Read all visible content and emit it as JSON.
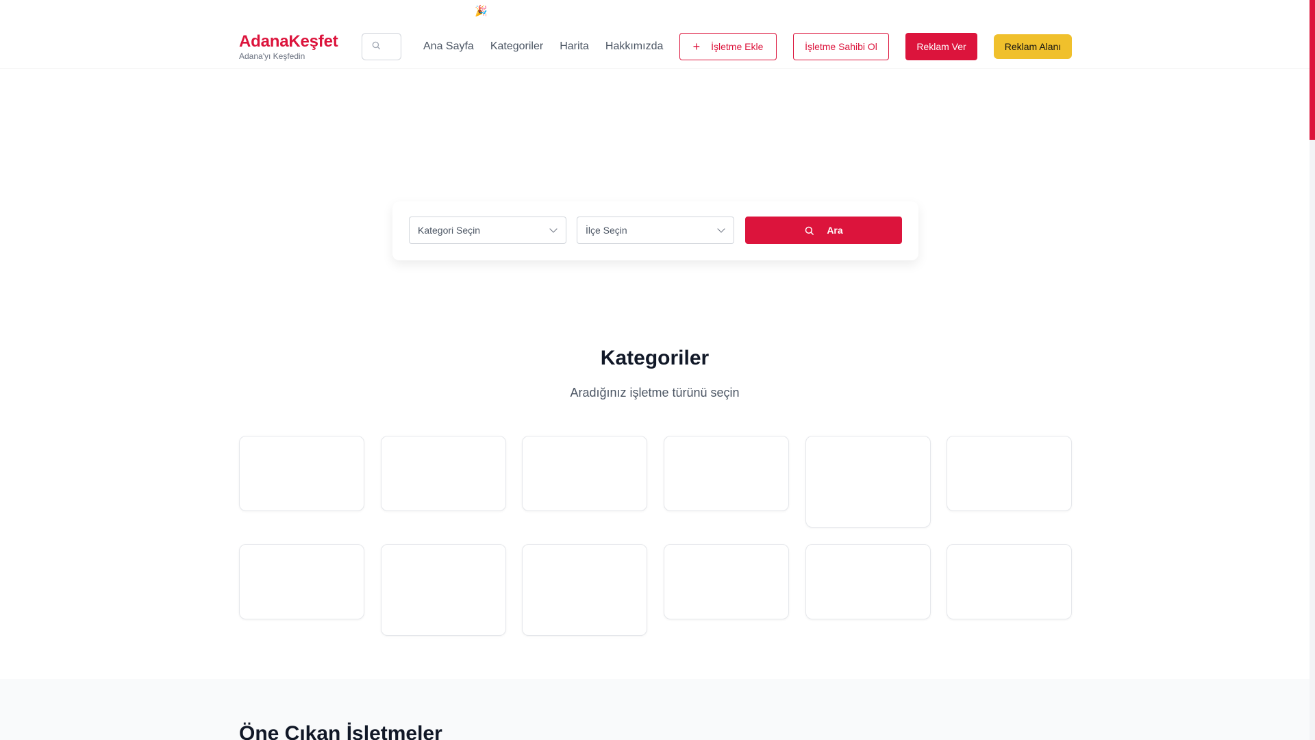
{
  "announcement": {
    "icon": "party-popper-icon",
    "text": "🎉"
  },
  "brand": {
    "title": "AdanaKeşfet",
    "subtitle": "Adana'yı Keşfedin",
    "color": "#dc143c"
  },
  "nav": {
    "items": [
      "Ana Sayfa",
      "Kategoriler",
      "Harita",
      "Hakkımızda"
    ]
  },
  "actions": {
    "add_business": "İşletme Ekle",
    "become_owner": "İşletme Sahibi Ol",
    "advertise": "Reklam Ver",
    "ad_area": "Reklam Alanı"
  },
  "search": {
    "category_placeholder": "Kategori Seçin",
    "district_placeholder": "İlçe Seçin",
    "button_label": "Ara"
  },
  "categories": {
    "title": "Kategoriler",
    "subtitle": "Aradığınız işletme türünü seçin",
    "card_count": 12
  },
  "featured": {
    "title": "Öne Çıkan İşletmeler"
  },
  "colors": {
    "accent": "#dc143c",
    "yellow": "#f0c02c",
    "muted_bg": "#f9fafb"
  }
}
